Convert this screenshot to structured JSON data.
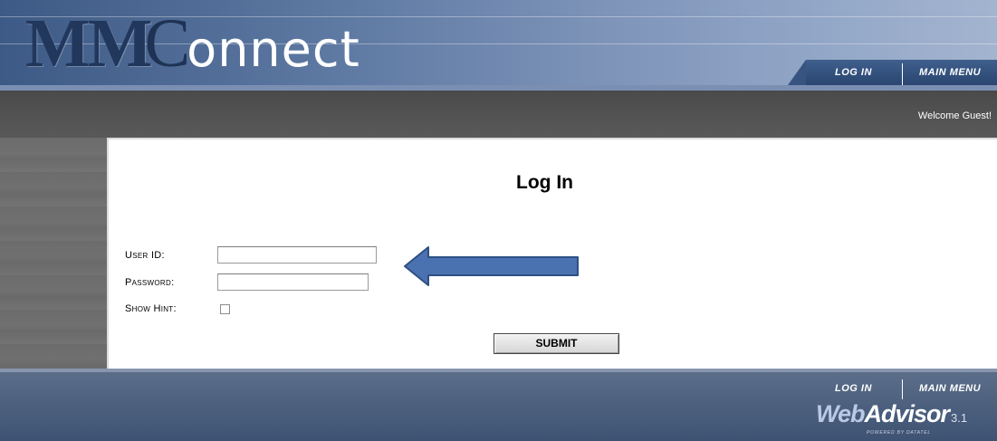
{
  "header": {
    "logo_mm": "MM",
    "logo_c": "C",
    "logo_connect": "onnect",
    "nav": {
      "login": "LOG IN",
      "main_menu": "MAIN MENU"
    }
  },
  "welcome": "Welcome Guest!",
  "page": {
    "title": "Log In",
    "fields": {
      "user_id_label": "User ID:",
      "user_id_value": "",
      "password_label": "Password:",
      "password_value": "",
      "show_hint_label": "Show Hint:",
      "show_hint_checked": false
    },
    "submit_label": "SUBMIT"
  },
  "annotation": {
    "arrow_color": "#4a72b0",
    "arrow_direction": "left"
  },
  "footer": {
    "nav": {
      "login": "LOG IN",
      "main_menu": "MAIN MENU"
    },
    "brand_web": "Web",
    "brand_advisor": "Advisor",
    "brand_version": "3.1",
    "powered": "POWERED BY DATATEL"
  },
  "colors": {
    "header_dark": "#3d5a86",
    "header_light": "#a3b4cf",
    "band_grey": "#595959",
    "footer_blue": "#3e5273"
  }
}
